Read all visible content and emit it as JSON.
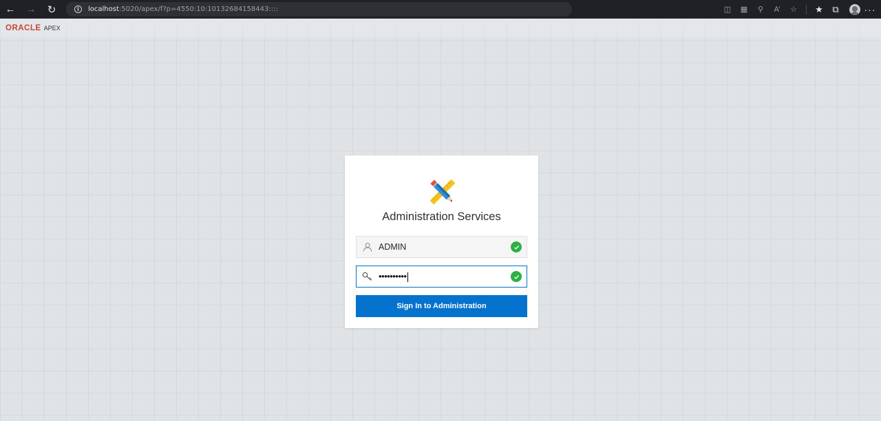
{
  "browser": {
    "url_host": "localhost",
    "url_rest": ":5020/apex/f?p=4550:10:10132684158443::::",
    "icons": [
      "back-arrow-icon",
      "forward-arrow-icon",
      "reload-icon",
      "info-icon",
      "read-aloud-icon",
      "qr-code-icon",
      "key-icon",
      "text-size-icon",
      "add-favorite-icon",
      "favorites-icon",
      "collections-icon",
      "profile-icon",
      "more-icon"
    ]
  },
  "header": {
    "brand": "ORACLE",
    "product": "APEX"
  },
  "login": {
    "title": "Administration Services",
    "username_value": "ADMIN",
    "password_mask": "••••••••••",
    "sign_in_label": "Sign In to Administration",
    "accent_color": "#0572ce",
    "valid_color": "#2bb045"
  }
}
